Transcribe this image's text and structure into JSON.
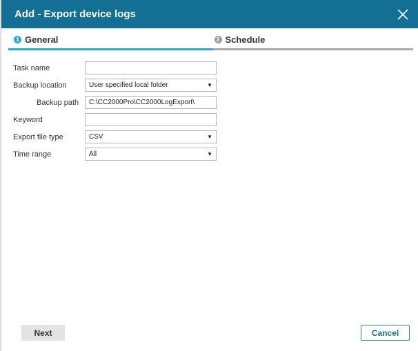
{
  "dialog": {
    "title": "Add - Export device logs",
    "close_icon": "close-icon"
  },
  "steps": [
    {
      "number": "1",
      "label": "General",
      "state": "active"
    },
    {
      "number": "2",
      "label": "Schedule",
      "state": "inactive"
    }
  ],
  "form": {
    "task_name": {
      "label": "Task name",
      "value": ""
    },
    "backup_location": {
      "label": "Backup location",
      "value": "User specified local folder"
    },
    "backup_path": {
      "label": "Backup path",
      "value": "C:\\CC2000Pro\\CC2000LogExport\\"
    },
    "keyword": {
      "label": "Keyword",
      "value": ""
    },
    "export_file_type": {
      "label": "Export file type",
      "value": "CSV"
    },
    "time_range": {
      "label": "Time range",
      "value": "All"
    }
  },
  "footer": {
    "next_label": "Next",
    "cancel_label": "Cancel"
  },
  "colors": {
    "titlebar": "#136f94",
    "active_step": "#2aa8d8",
    "inactive_step": "#a8a8a8",
    "cancel_border": "#2a87b8"
  }
}
